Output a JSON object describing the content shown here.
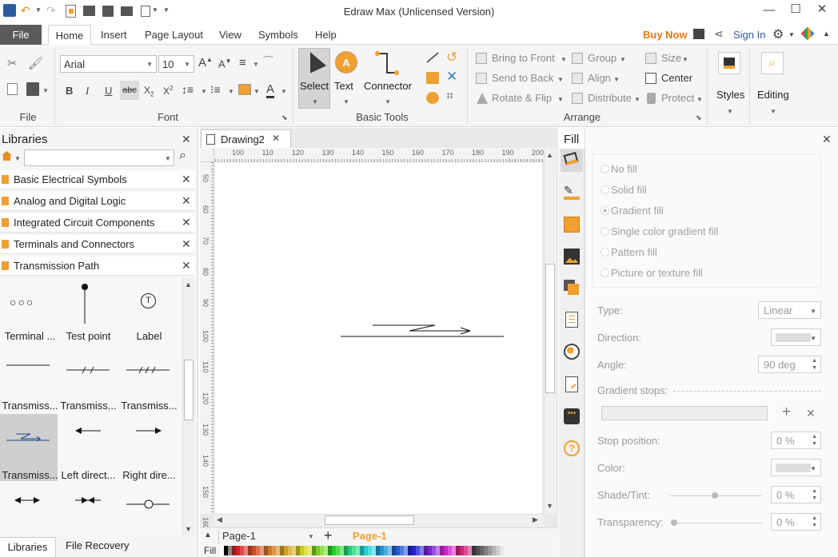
{
  "window": {
    "title": "Edraw Max (Unlicensed Version)",
    "minimize": "—",
    "maximize": "☐",
    "close": "✕"
  },
  "quick_access": {
    "app_icon": "app-logo-icon",
    "undo": "↶",
    "redo": "↷"
  },
  "menu": {
    "file": "File",
    "tabs": [
      "Home",
      "Insert",
      "Page Layout",
      "View",
      "Symbols",
      "Help"
    ],
    "buy_now": "Buy Now",
    "sign_in": "Sign In"
  },
  "ribbon": {
    "groups": {
      "file": "File",
      "font": "Font",
      "basic_tools": "Basic Tools",
      "arrange": "Arrange"
    },
    "font_name": "Arial",
    "font_size": "10",
    "select": "Select",
    "text": "Text",
    "connector": "Connector",
    "arrange": {
      "bring_to_front": "Bring to Front",
      "send_to_back": "Send to Back",
      "rotate_flip": "Rotate & Flip",
      "group": "Group",
      "align": "Align",
      "distribute": "Distribute",
      "size": "Size",
      "center": "Center",
      "protect": "Protect"
    },
    "styles": "Styles",
    "editing": "Editing"
  },
  "libraries": {
    "title": "Libraries",
    "search_placeholder": "",
    "items": [
      "Basic Electrical Symbols",
      "Analog and Digital Logic",
      "Integrated Circuit Components",
      "Terminals and Connectors",
      "Transmission Path"
    ],
    "shapes": [
      "Terminal ...",
      "Test point",
      "Label",
      "Transmiss...",
      "Transmiss...",
      "Transmiss...",
      "Transmiss...",
      "Left direct...",
      "Right dire..."
    ],
    "label_glyph": "T",
    "bottom_tabs": [
      "Libraries",
      "File Recovery"
    ]
  },
  "document": {
    "tab": "Drawing2",
    "ruler_h": [
      "100",
      "110",
      "120",
      "130",
      "140",
      "150",
      "160",
      "170",
      "180",
      "190",
      "200"
    ],
    "ruler_v": [
      "50",
      "60",
      "70",
      "80",
      "90",
      "100",
      "110",
      "120",
      "130",
      "140",
      "150",
      "160"
    ],
    "page_selector": "Page-1",
    "active_page": "Page-1",
    "fill_label": "Fill"
  },
  "fill_panel": {
    "title": "Fill",
    "options": [
      "No fill",
      "Solid fill",
      "Gradient fill",
      "Single color gradient fill",
      "Pattern fill",
      "Picture or texture fill"
    ],
    "selected_option": "Gradient fill",
    "type_label": "Type:",
    "type_value": "Linear",
    "direction_label": "Direction:",
    "angle_label": "Angle:",
    "angle_value": "90 deg",
    "gradient_stops_label": "Gradient stops:",
    "stop_position_label": "Stop position:",
    "stop_position_value": "0 %",
    "color_label": "Color:",
    "shade_label": "Shade/Tint:",
    "shade_value": "0 %",
    "transparency_label": "Transparency:",
    "transparency_value": "0 %"
  },
  "colors": {
    "accent_orange": "#f0a030",
    "file_tab": "#5a5a5a",
    "buy_now": "#e07a10"
  }
}
